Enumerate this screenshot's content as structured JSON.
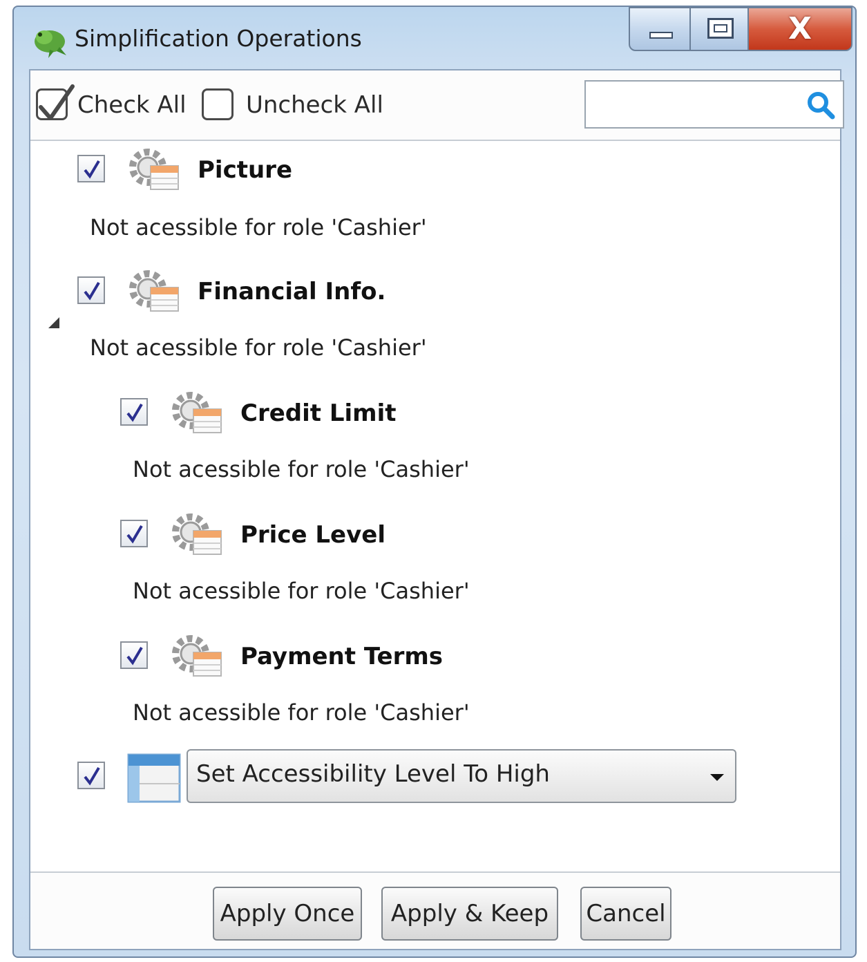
{
  "window": {
    "title": "Simplification Operations",
    "app_icon": "green-lizard-icon",
    "controls": {
      "minimize": "minimize-icon",
      "maximize": "maximize-icon",
      "close_label": "X"
    }
  },
  "toolbar": {
    "check_all_label": "Check All",
    "uncheck_all_label": "Uncheck All",
    "search": {
      "value": "",
      "placeholder": "",
      "icon": "search-icon"
    }
  },
  "operations": [
    {
      "title": "Picture",
      "description": "Not acessible for role 'Cashier'",
      "checked": true,
      "icon": "gear-form-icon"
    },
    {
      "title": "Financial Info.",
      "description": "Not acessible for role 'Cashier'",
      "checked": true,
      "icon": "gear-form-icon",
      "expanded": true,
      "children": [
        {
          "title": "Credit Limit",
          "description": "Not acessible for role 'Cashier'",
          "checked": true,
          "icon": "gear-form-icon"
        },
        {
          "title": "Price Level",
          "description": "Not acessible for role 'Cashier'",
          "checked": true,
          "icon": "gear-form-icon"
        },
        {
          "title": "Payment Terms",
          "description": "Not acessible for role 'Cashier'",
          "checked": true,
          "icon": "gear-form-icon"
        }
      ]
    }
  ],
  "accessibility": {
    "checked": true,
    "icon": "layout-icon",
    "selected": "Set Accessibility Level To High"
  },
  "footer": {
    "apply_once_label": "Apply Once",
    "apply_keep_label": "Apply & Keep",
    "cancel_label": "Cancel"
  },
  "colors": {
    "check_mark": "#2b2f8f",
    "search_icon": "#1f8fe0",
    "close_button": "#c9452b",
    "titlebar": "#c9dcef"
  }
}
